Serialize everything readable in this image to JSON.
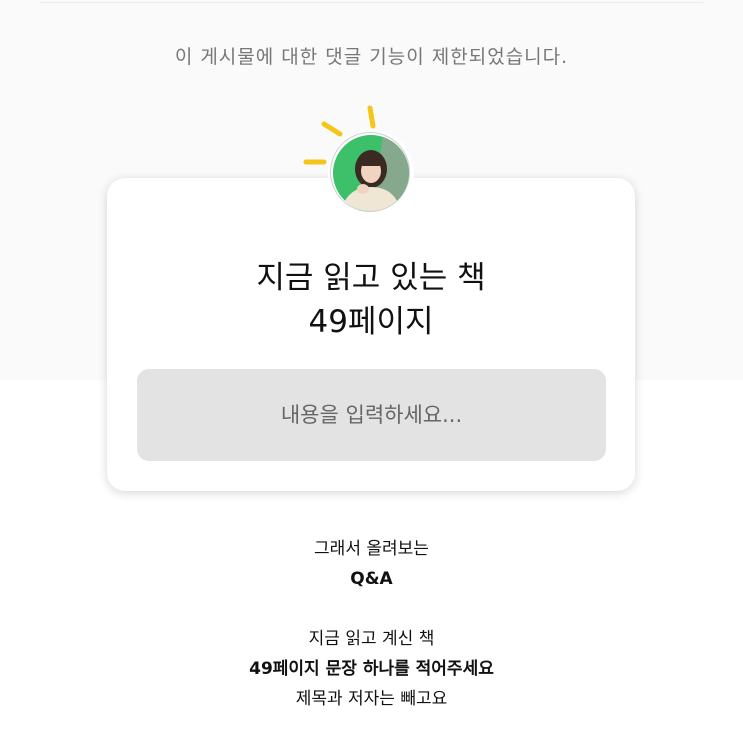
{
  "notice": "이 게시물에 대한 댓글 기능이 제한되었습니다.",
  "question_card": {
    "title_line1": "지금 읽고 있는 책",
    "title_line2": "49페이지",
    "input_placeholder": "내용을 입력하세요..."
  },
  "caption": {
    "line1": "그래서 올려보는",
    "line2": "Q&A",
    "line3": "지금 읽고 계신 책",
    "line4": "49페이지 문장 하나를 적어주세요",
    "line5": "제목과 저자는 빼고요"
  },
  "colors": {
    "burst": "#f5c518",
    "avatar_bg_green": "#3cc06a",
    "input_bg": "#e3e3e3"
  }
}
